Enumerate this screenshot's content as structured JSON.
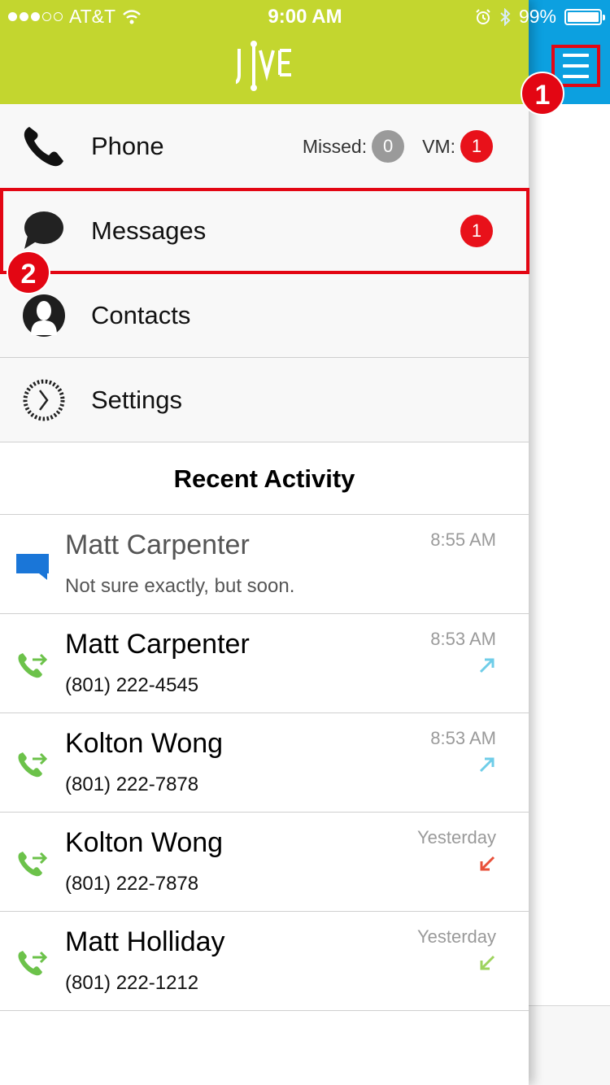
{
  "status_bar": {
    "carrier": "AT&T",
    "time": "9:00 AM",
    "battery": "99%",
    "battery_level": 0.99
  },
  "app": {
    "logo_text": "JIVE",
    "header_color": "#c3d62f",
    "side_header_color": "#0ca0e0",
    "highlight_color": "#e30613"
  },
  "nav": {
    "phone": {
      "label": "Phone",
      "missed_label": "Missed:",
      "missed_count": "0",
      "vm_label": "VM:",
      "vm_count": "1"
    },
    "messages": {
      "label": "Messages",
      "badge": "1"
    },
    "contacts": {
      "label": "Contacts"
    },
    "settings": {
      "label": "Settings"
    }
  },
  "markers": {
    "first": "1",
    "second": "2"
  },
  "recent": {
    "title": "Recent Activity",
    "items": [
      {
        "type": "message",
        "name": "Matt Carpenter",
        "detail": "Not sure exactly, but soon.",
        "time": "8:55 AM",
        "direction": ""
      },
      {
        "type": "call",
        "name": "Matt Carpenter",
        "detail": "(801) 222-4545",
        "time": "8:53 AM",
        "direction": "outgoing"
      },
      {
        "type": "call",
        "name": "Kolton Wong",
        "detail": "(801) 222-7878",
        "time": "8:53 AM",
        "direction": "outgoing"
      },
      {
        "type": "call",
        "name": "Kolton Wong",
        "detail": "(801) 222-7878",
        "time": "Yesterday",
        "direction": "missed"
      },
      {
        "type": "call",
        "name": "Matt Holliday",
        "detail": "(801) 222-1212",
        "time": "Yesterday",
        "direction": "incoming"
      }
    ]
  }
}
